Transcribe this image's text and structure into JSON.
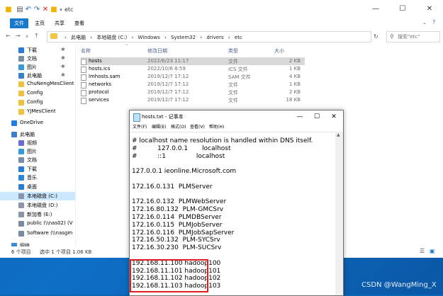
{
  "explorer": {
    "window_title": "etc",
    "ribbon_tabs": [
      {
        "label": "文件",
        "active": true
      },
      {
        "label": "主页",
        "active": false
      },
      {
        "label": "共享",
        "active": false
      },
      {
        "label": "查看",
        "active": false
      }
    ],
    "breadcrumb": [
      "此电脑",
      "本地磁盘 (C:)",
      "Windows",
      "System32",
      "drivers",
      "etc"
    ],
    "search_placeholder": "搜索\"etc\"",
    "sidebar": [
      {
        "label": "下载",
        "icon": "download-icon",
        "pinned": true
      },
      {
        "label": "文档",
        "icon": "document-icon",
        "pinned": true
      },
      {
        "label": "图片",
        "icon": "pictures-icon",
        "pinned": true
      },
      {
        "label": "此电脑",
        "icon": "computer-icon",
        "pinned": true
      },
      {
        "label": "ChuNengMesClient",
        "icon": "folder-icon",
        "pinned": false
      },
      {
        "label": "Config",
        "icon": "folder-icon",
        "pinned": false
      },
      {
        "label": "Config",
        "icon": "folder-icon",
        "pinned": false
      },
      {
        "label": "YJMesClient",
        "icon": "folder-icon",
        "pinned": false
      },
      {
        "label": "OneDrive",
        "icon": "cloud-icon",
        "pinned": false
      },
      {
        "label": "此电脑",
        "icon": "computer-icon",
        "pinned": false
      },
      {
        "label": "视频",
        "icon": "video-icon",
        "pinned": false
      },
      {
        "label": "图片",
        "icon": "pictures-icon",
        "pinned": false
      },
      {
        "label": "文档",
        "icon": "document-icon",
        "pinned": false
      },
      {
        "label": "下载",
        "icon": "download-icon",
        "pinned": false
      },
      {
        "label": "音乐",
        "icon": "music-icon",
        "pinned": false
      },
      {
        "label": "桌面",
        "icon": "desktop-icon",
        "pinned": false
      },
      {
        "label": "本地磁盘 (C:)",
        "icon": "drive-icon",
        "pinned": false,
        "selected": true
      },
      {
        "label": "本地磁盘 (D:)",
        "icon": "drive-icon",
        "pinned": false
      },
      {
        "label": "新加卷 (E:)",
        "icon": "drive-icon",
        "pinned": false
      },
      {
        "label": "public (\\\\nas02) (V",
        "icon": "network-drive-icon",
        "pinned": false
      },
      {
        "label": "Software (\\\\nasgm",
        "icon": "network-drive-icon",
        "pinned": false
      },
      {
        "label": "网络",
        "icon": "network-icon",
        "pinned": false
      }
    ],
    "columns": {
      "name": "名称",
      "date": "修改日期",
      "type": "类型",
      "size": "大小"
    },
    "files": [
      {
        "name": "hosts",
        "date": "2022/6/23 11:17",
        "type": "文件",
        "size": "2 KB",
        "selected": true
      },
      {
        "name": "hosts.ics",
        "date": "2022/10/6 8:59",
        "type": "ICS 文件",
        "size": "1 KB"
      },
      {
        "name": "lmhosts.sam",
        "date": "2019/12/7 17:12",
        "type": "SAM 文件",
        "size": "4 KB"
      },
      {
        "name": "networks",
        "date": "2019/12/7 17:12",
        "type": "文件",
        "size": "1 KB"
      },
      {
        "name": "protocol",
        "date": "2019/12/7 17:12",
        "type": "文件",
        "size": "2 KB"
      },
      {
        "name": "services",
        "date": "2019/12/7 17:12",
        "type": "文件",
        "size": "18 KB"
      }
    ],
    "status": {
      "count": "6 个项目",
      "selected": "选中 1 个项目  1.06 KB"
    }
  },
  "notepad": {
    "title": "hosts.txt - 记事本",
    "menu": [
      "文件(F)",
      "编辑(E)",
      "格式(O)",
      "查看(V)",
      "帮助(H)"
    ],
    "lines": [
      "# localhost name resolution is handled within DNS itself.",
      "#          127.0.0.1       localhost",
      "#          ::1               localhost",
      "",
      "127.0.0.1 ieonline.Microsoft.com",
      "",
      "172.16.0.131  PLMServer",
      "",
      "172.16.0.132  PLMWebServer",
      "172.16.80.132  PLM-GMCSrv",
      "172.16.0.114  PLMDBServer",
      "172.16.0.115  PLMJobServer",
      "172.16.0.116  PLMJobSapServer",
      "172.16.50.132  PLM-SYCSrv",
      "172.16.30.230  PLM-SUCSrv",
      "",
      "192.168.11.100 hadoop100",
      "192.168.11.101 hadoop101",
      "192.168.11.102 hadoop102",
      "192.168.11.103 hadoop103"
    ]
  },
  "watermark": "CSDN @WangMing_X",
  "colors": {
    "accent": "#1979ca",
    "highlight": "#e02020",
    "selection": "#cce8ff"
  }
}
